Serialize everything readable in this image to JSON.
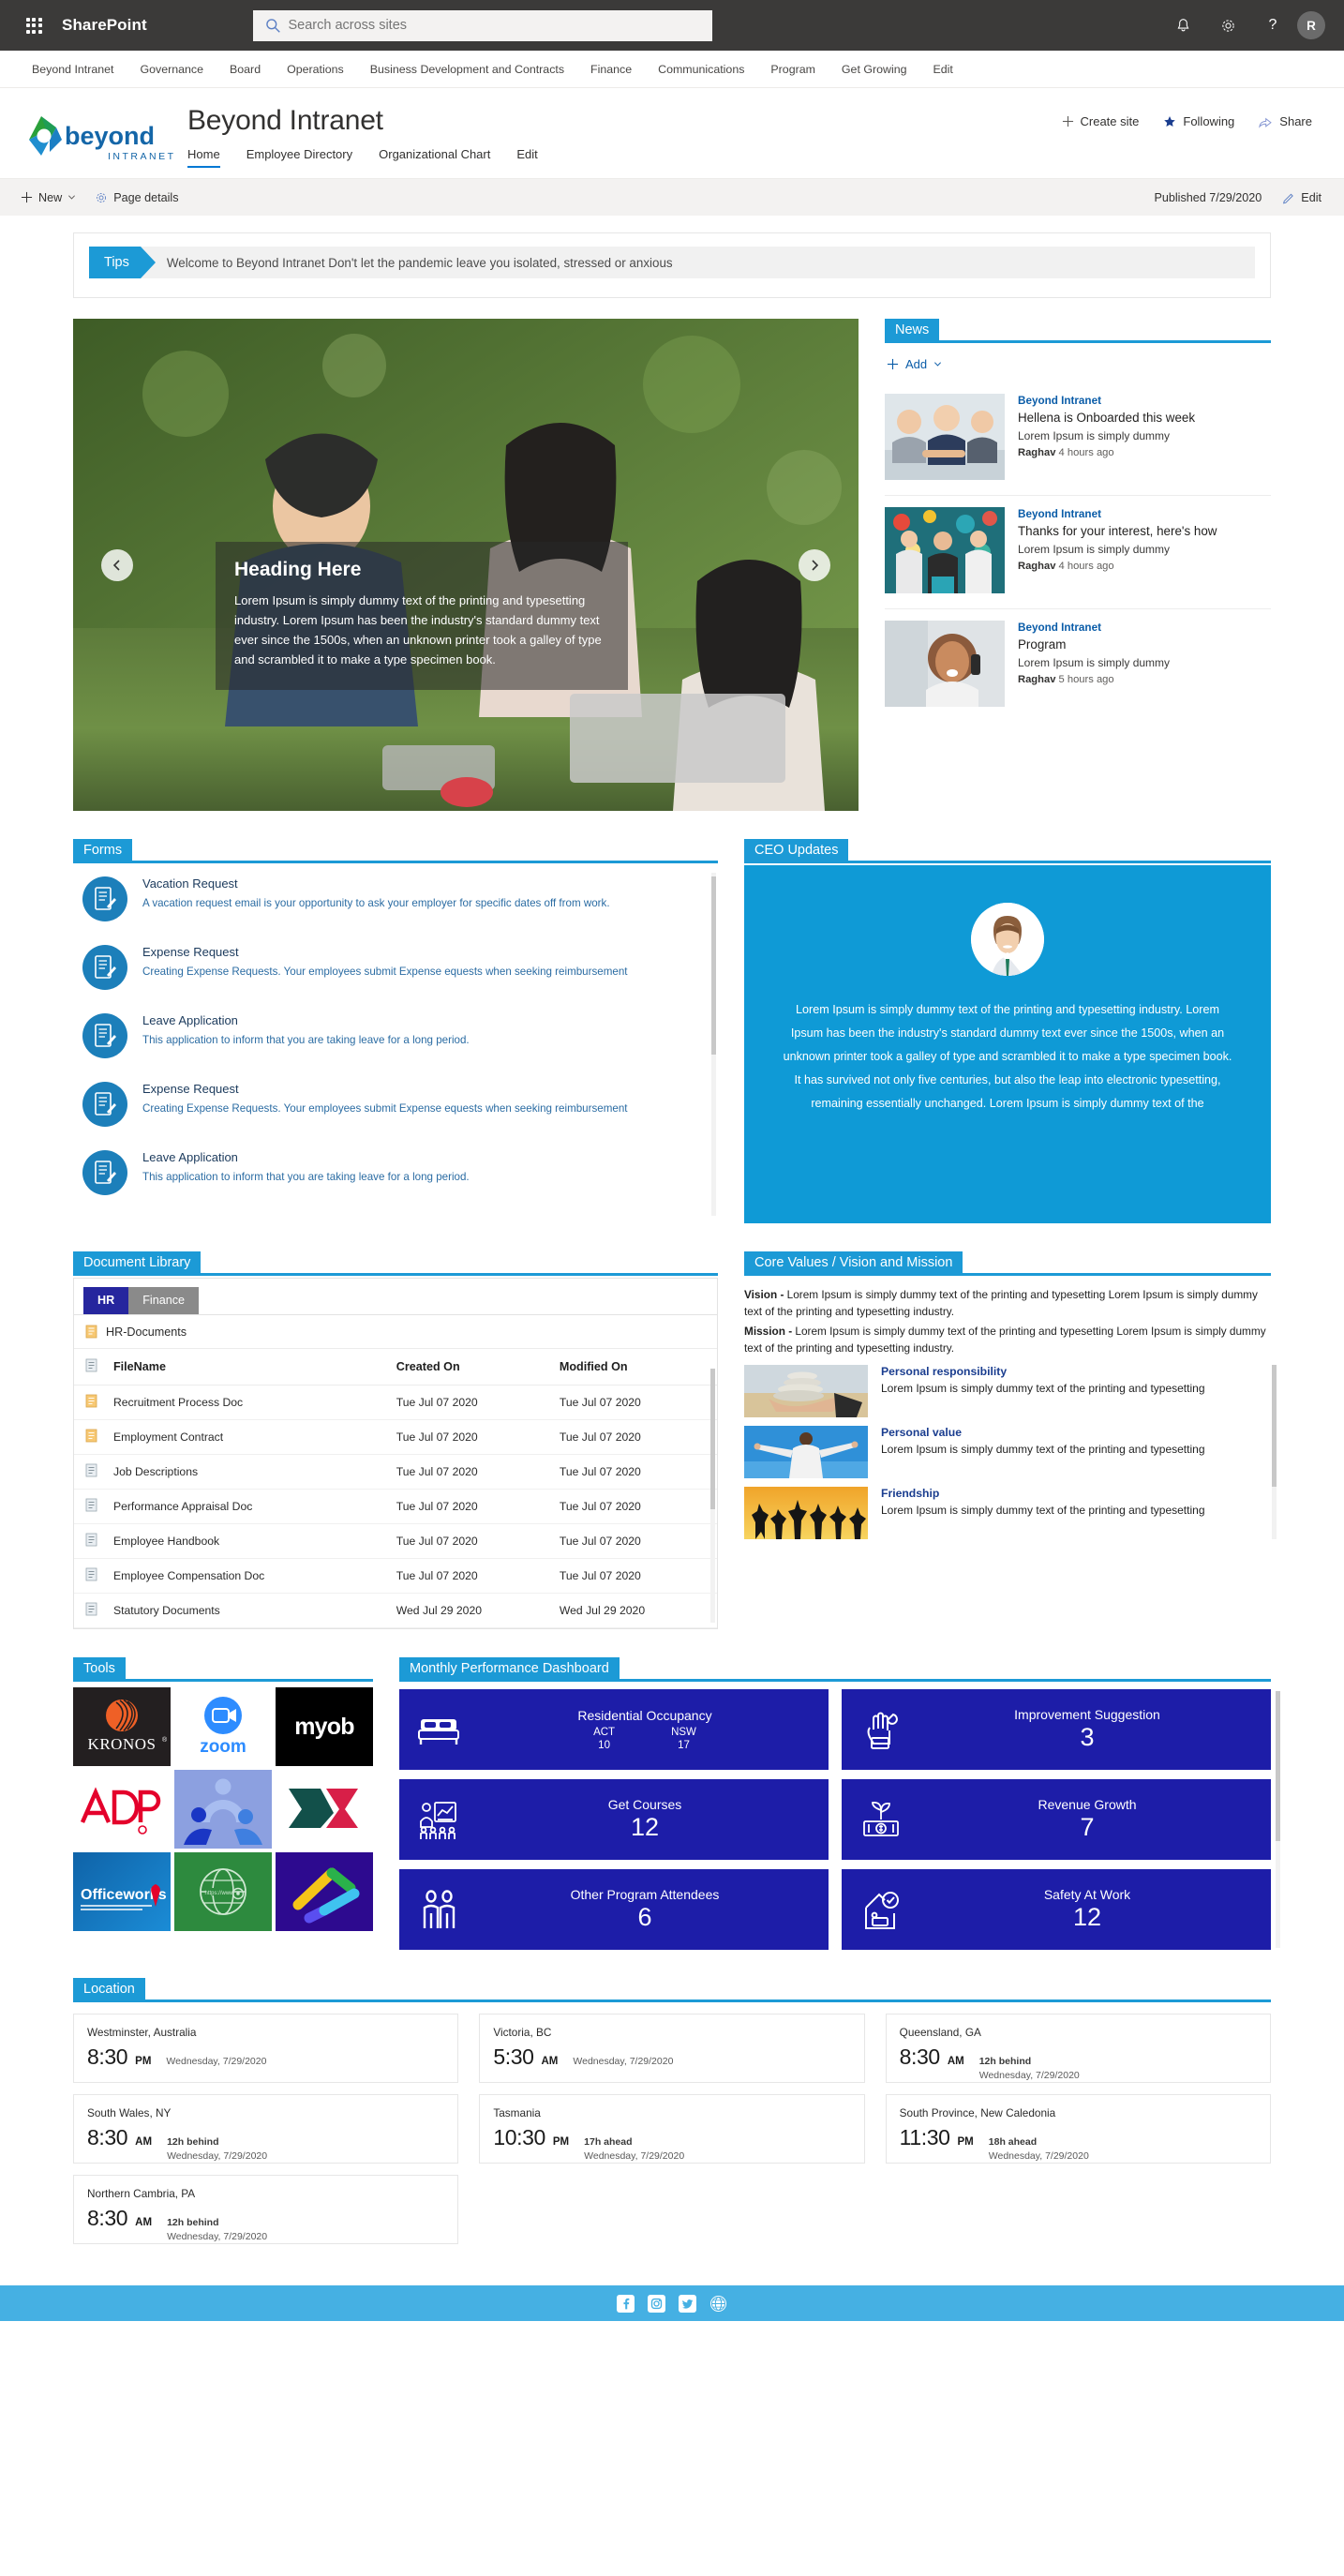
{
  "suite": {
    "brand": "SharePoint",
    "search_placeholder": "Search across sites",
    "icons": {
      "waffle": "app-launcher-icon",
      "search": "search-icon",
      "bell": "notifications-icon",
      "gear": "settings-icon",
      "help": "help-icon"
    },
    "avatar_initial": "R"
  },
  "hub_nav": [
    {
      "label": "Beyond Intranet"
    },
    {
      "label": "Governance"
    },
    {
      "label": "Board"
    },
    {
      "label": "Operations"
    },
    {
      "label": "Business Development and Contracts"
    },
    {
      "label": "Finance"
    },
    {
      "label": "Communications"
    },
    {
      "label": "Program"
    },
    {
      "label": "Get Growing"
    },
    {
      "label": "Edit"
    }
  ],
  "site": {
    "logo_word": "beyond",
    "logo_sub": "INTRANET",
    "title": "Beyond Intranet",
    "nav": [
      {
        "label": "Home",
        "active": true
      },
      {
        "label": "Employee Directory",
        "active": false
      },
      {
        "label": "Organizational Chart",
        "active": false
      },
      {
        "label": "Edit",
        "active": false
      }
    ],
    "actions": [
      {
        "label": "Create site",
        "icon": "plus-icon"
      },
      {
        "label": "Following",
        "icon": "star-icon"
      },
      {
        "label": "Share",
        "icon": "share-icon"
      }
    ]
  },
  "command_bar": {
    "new_label": "New",
    "page_details_label": "Page details",
    "published_label": "Published 7/29/2020",
    "edit_label": "Edit"
  },
  "tips": {
    "badge": "Tips",
    "message": "Welcome to Beyond Intranet Don't let the pandemic leave you isolated, stressed or anxious"
  },
  "hero": {
    "heading": "Heading Here",
    "paragraph": "Lorem Ipsum is simply dummy text of the printing and typesetting industry. Lorem Ipsum has been the industry's standard dummy text ever since the 1500s, when an unknown printer took a galley of type and scrambled it to make a type specimen book.",
    "prev_icon": "chevron-left-icon",
    "next_icon": "chevron-right-icon"
  },
  "news": {
    "title": "News",
    "add_label": "Add",
    "items": [
      {
        "site": "Beyond Intranet",
        "title": "Hellena is Onboarded this week",
        "desc": "Lorem Ipsum is simply dummy",
        "author": "Raghav",
        "time": "4 hours ago"
      },
      {
        "site": "Beyond Intranet",
        "title": "Thanks for your interest, here's how",
        "desc": "Lorem Ipsum is simply dummy",
        "author": "Raghav",
        "time": "4 hours ago"
      },
      {
        "site": "Beyond Intranet",
        "title": "Program",
        "desc": "Lorem Ipsum is simply dummy",
        "author": "Raghav",
        "time": "5 hours ago"
      }
    ]
  },
  "forms": {
    "title": "Forms",
    "items": [
      {
        "name": "Vacation Request",
        "desc": "A vacation request email is your opportunity to ask  your employer for specific dates off from work."
      },
      {
        "name": "Expense Request",
        "desc": "Creating Expense Requests. Your employees submit Expense equests when seeking reimbursement"
      },
      {
        "name": "Leave Application",
        "desc": "This application to inform that you are taking leave  for a  long period."
      },
      {
        "name": "Expense Request",
        "desc": "Creating Expense Requests. Your employees submit Expense equests when seeking reimbursement"
      },
      {
        "name": "Leave Application",
        "desc": "This application to inform that you are taking leave  for a  long period."
      }
    ]
  },
  "ceo": {
    "title": "CEO Updates",
    "body": "Lorem Ipsum is simply dummy text of the printing and typesetting industry. Lorem Ipsum has been the industry's standard dummy text ever since the 1500s, when an unknown printer took a galley of type and scrambled it to make a type specimen book. It has survived not only five centuries, but also the leap into electronic typesetting, remaining essentially unchanged. Lorem Ipsum is simply dummy text of the"
  },
  "doc_library": {
    "title": "Document Library",
    "tabs": [
      {
        "label": "HR",
        "active": true
      },
      {
        "label": "Finance",
        "active": false
      }
    ],
    "folder": "HR-Documents",
    "columns": [
      "FileName",
      "Created On",
      "Modified On"
    ],
    "rows": [
      {
        "name": "Recruitment Process Doc",
        "created": "Tue Jul 07 2020",
        "modified": "Tue Jul 07 2020",
        "icon": "word-doc-icon"
      },
      {
        "name": "Employment Contract",
        "created": "Tue Jul 07 2020",
        "modified": "Tue Jul 07 2020",
        "icon": "word-doc-icon"
      },
      {
        "name": "Job Descriptions",
        "created": "Tue Jul 07 2020",
        "modified": "Tue Jul 07 2020",
        "icon": "file-icon"
      },
      {
        "name": "Performance Appraisal Doc",
        "created": "Tue Jul 07 2020",
        "modified": "Tue Jul 07 2020",
        "icon": "file-icon"
      },
      {
        "name": "Employee Handbook",
        "created": "Tue Jul 07 2020",
        "modified": "Tue Jul 07 2020",
        "icon": "file-icon"
      },
      {
        "name": "Employee Compensation Doc",
        "created": "Tue Jul 07 2020",
        "modified": "Tue Jul 07 2020",
        "icon": "file-icon"
      },
      {
        "name": "Statutory Documents",
        "created": "Wed Jul 29 2020",
        "modified": "Wed Jul 29 2020",
        "icon": "file-icon"
      }
    ]
  },
  "core_values": {
    "title": "Core Values / Vision and Mission",
    "vision_label": "Vision -",
    "vision_text": " Lorem Ipsum is simply dummy text of the printing and typesetting Lorem Ipsum is simply dummy text of the printing and typesetting industry.",
    "mission_label": "Mission -",
    "mission_text": " Lorem Ipsum is simply dummy text of the printing and typesetting Lorem Ipsum is simply dummy text of the printing and typesetting industry.",
    "items": [
      {
        "title": "Personal responsibility",
        "desc": "Lorem Ipsum is simply dummy text of the printing and typesetting",
        "image": "stones-in-hand-photo"
      },
      {
        "title": "Personal value",
        "desc": "Lorem Ipsum is simply dummy text of the printing and typesetting",
        "image": "man-arms-open-sky-photo"
      },
      {
        "title": "Friendship",
        "desc": "Lorem Ipsum is simply dummy text of the printing and typesetting",
        "image": "jumping-silhouettes-sunset-photo"
      }
    ]
  },
  "tools": {
    "title": "Tools",
    "items": [
      {
        "name": "KRONOS",
        "logo": "kronos-logo"
      },
      {
        "name": "zoom",
        "logo": "zoom-logo"
      },
      {
        "name": "myob",
        "logo": "myob-logo"
      },
      {
        "name": "ADP",
        "logo": "adp-logo"
      },
      {
        "name": "Community",
        "logo": "people-circle-logo"
      },
      {
        "name": "Deputy",
        "logo": "chevron-teal-red-logo"
      },
      {
        "name": "Officeworks",
        "logo": "officeworks-logo"
      },
      {
        "name": "Globe",
        "logo": "globe-green-logo"
      },
      {
        "name": "Checkmark",
        "logo": "checkmark-purple-logo"
      }
    ]
  },
  "dashboard": {
    "title": "Monthly Performance Dashboard",
    "tiles": [
      {
        "label": "Residential Occupancy",
        "icon": "bed-icon",
        "multi": true,
        "subs": [
          {
            "key": "ACT",
            "value": "10"
          },
          {
            "key": "NSW",
            "value": "17"
          }
        ]
      },
      {
        "label": "Improvement Suggestion",
        "icon": "hand-wrench-icon",
        "value": "3"
      },
      {
        "label": "Get Courses",
        "icon": "training-chart-icon",
        "value": "12"
      },
      {
        "label": "Revenue Growth",
        "icon": "money-plant-icon",
        "value": "7"
      },
      {
        "label": "Other Program Attendees",
        "icon": "two-people-icon",
        "value": "6"
      },
      {
        "label": "Safety At Work",
        "icon": "house-check-icon",
        "value": "12"
      }
    ]
  },
  "location": {
    "title": "Location",
    "cards": [
      {
        "name": "Westminster, Australia",
        "time": "8:30",
        "ampm": "PM",
        "offset": "",
        "date": "Wednesday, 7/29/2020"
      },
      {
        "name": "Victoria, BC",
        "time": "5:30",
        "ampm": "AM",
        "offset": "",
        "date": "Wednesday, 7/29/2020"
      },
      {
        "name": "Queensland, GA",
        "time": "8:30",
        "ampm": "AM",
        "offset": "12h behind",
        "date": "Wednesday, 7/29/2020"
      },
      {
        "name": "South Wales, NY",
        "time": "8:30",
        "ampm": "AM",
        "offset": "12h behind",
        "date": "Wednesday, 7/29/2020"
      },
      {
        "name": "Tasmania",
        "time": "10:30",
        "ampm": "PM",
        "offset": "17h ahead",
        "date": "Wednesday, 7/29/2020"
      },
      {
        "name": "South Province, New Caledonia",
        "time": "11:30",
        "ampm": "PM",
        "offset": "18h ahead",
        "date": "Wednesday, 7/29/2020"
      },
      {
        "name": "Northern Cambria, PA",
        "time": "8:30",
        "ampm": "AM",
        "offset": "12h behind",
        "date": "Wednesday, 7/29/2020"
      }
    ]
  },
  "footer": {
    "social": [
      {
        "name": "facebook-icon"
      },
      {
        "name": "instagram-icon"
      },
      {
        "name": "twitter-icon"
      },
      {
        "name": "website-globe-icon"
      }
    ]
  },
  "colors": {
    "accent_blue": "#1c9ad6",
    "nav_blue": "#0078d4",
    "dash_blue": "#1d1da8",
    "ceo_blue": "#0f9ad6",
    "footer_blue": "#45b0e3",
    "suite_bar": "#3b3a39"
  }
}
